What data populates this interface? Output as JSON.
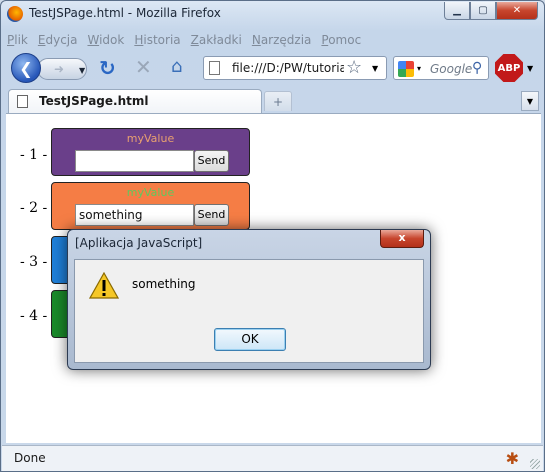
{
  "window": {
    "title": "TestJSPage.html - Mozilla Firefox"
  },
  "menu": [
    "Plik",
    "Edycja",
    "Widok",
    "Historia",
    "Zakładki",
    "Narzędzia",
    "Pomoc"
  ],
  "navbar": {
    "url": "file:///D:/PW/tutoria",
    "search_placeholder": "Google",
    "adblock_label": "ABP"
  },
  "tab": {
    "label": "TestJSPage.html",
    "newtab_label": "+"
  },
  "rows": [
    {
      "label": "- 1 -",
      "title": "myValue",
      "value": "",
      "button": "Send",
      "bg": "#6a3f8a",
      "title_color": "#e8a070"
    },
    {
      "label": "- 2 -",
      "title": "myValue",
      "value": "something",
      "button": "Send",
      "bg": "#f57d45",
      "title_color": "#5ec85e"
    },
    {
      "label": "- 3 -",
      "bg": "#1f7fd8"
    },
    {
      "label": "- 4 -",
      "bg": "#1a8a2a"
    }
  ],
  "status": {
    "text": "Done"
  },
  "dialog": {
    "title": "[Aplikacja JavaScript]",
    "close_label": "x",
    "message": "something",
    "ok_label": "OK"
  },
  "icons": {
    "back": "back-arrow-icon",
    "reload": "reload-icon",
    "stop": "stop-icon",
    "home": "home-icon",
    "bookmark": "star-icon",
    "warning": "warning-icon"
  }
}
